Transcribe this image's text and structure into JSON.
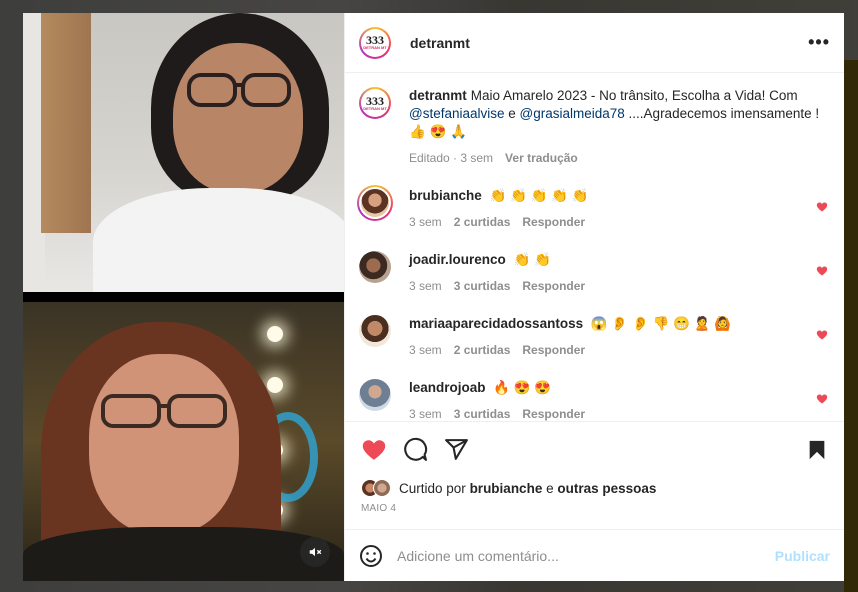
{
  "post": {
    "username": "detranmt",
    "more_label": "•••",
    "logo": {
      "mark": "333",
      "text": "DETRAN MT"
    },
    "caption": {
      "username": "detranmt",
      "text_1": "Maio Amarelo 2023 - No trânsito, Escolha a Vida! Com",
      "mention_1": "@stefaniaalvise",
      "joiner": " e ",
      "mention_2": "@grasialmeida78",
      "text_2": " ....Agradecemos imensamente ! 👍 😍 🙏",
      "edited": "Editado · 3 sem",
      "translate": "Ver tradução"
    }
  },
  "comments": [
    {
      "username": "brubianche",
      "text": "👏 👏 👏 👏 👏",
      "time": "3 sem",
      "likes": "2 curtidas",
      "reply": "Responder",
      "liked": true,
      "color": "#c98a6a"
    },
    {
      "username": "joadir.lourenco",
      "text": "👏 👏",
      "time": "3 sem",
      "likes": "3 curtidas",
      "reply": "Responder",
      "liked": true,
      "color": "#7a5a4a"
    },
    {
      "username": "mariaaparecidadossantoss",
      "text": "😱 👂 👂 👎 😁 🙎 🙆",
      "time": "3 sem",
      "likes": "2 curtidas",
      "reply": "Responder",
      "liked": true,
      "color": "#a87a5a"
    },
    {
      "username": "leandrojoab",
      "text": "🔥 😍 😍",
      "time": "3 sem",
      "likes": "3 curtidas",
      "reply": "Responder",
      "liked": true,
      "color": "#8aa0b8"
    }
  ],
  "likes_line": {
    "prefix": "Curtido por",
    "user": "brubianche",
    "joiner": "e",
    "others": "outras pessoas"
  },
  "date": "MAIO 4",
  "add_comment": {
    "placeholder": "Adicione um comentário...",
    "post_label": "Publicar"
  },
  "colors": {
    "like_red": "#ed4956",
    "link_blue": "#00376b",
    "muted": "#8e8e8e",
    "post_disabled": "#b2dffc"
  },
  "icons": [
    "heart-icon",
    "comment-icon",
    "share-icon",
    "bookmark-icon",
    "emoji-icon",
    "mute-icon",
    "more-icon"
  ]
}
